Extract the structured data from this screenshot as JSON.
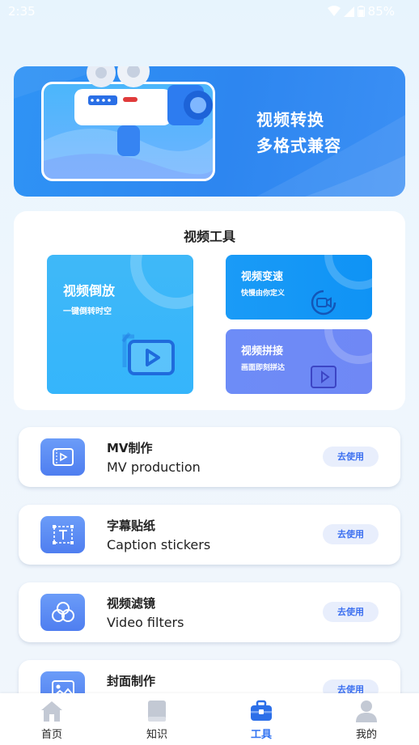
{
  "status_bar": {
    "time": "2:35",
    "battery": "85%"
  },
  "banner": {
    "line1": "视频转换",
    "line2": "多格式兼容"
  },
  "video_tools": {
    "title": "视频工具",
    "tiles": [
      {
        "name": "视频倒放",
        "sub": "一键倒转时空"
      },
      {
        "name": "视频变速",
        "sub": "快慢由你定义"
      },
      {
        "name": "视频拼接",
        "sub": "画面即刻拼达"
      }
    ]
  },
  "features": [
    {
      "title": "MV制作",
      "subtitle": "MV production",
      "button": "去使用",
      "icon": "film-icon"
    },
    {
      "title": "字幕贴纸",
      "subtitle": "Caption stickers",
      "button": "去使用",
      "icon": "text-frame-icon"
    },
    {
      "title": "视频滤镜",
      "subtitle": "Video filters",
      "button": "去使用",
      "icon": "filter-icon"
    },
    {
      "title": "封面制作",
      "subtitle": "",
      "button": "去使用",
      "icon": "image-icon"
    }
  ],
  "nav": [
    {
      "label": "首页",
      "icon": "home-icon"
    },
    {
      "label": "知识",
      "icon": "book-icon"
    },
    {
      "label": "工具",
      "icon": "toolbox-icon"
    },
    {
      "label": "我的",
      "icon": "user-icon"
    }
  ],
  "colors": {
    "accent": "#3073f2",
    "banner": "#2f93f5"
  }
}
